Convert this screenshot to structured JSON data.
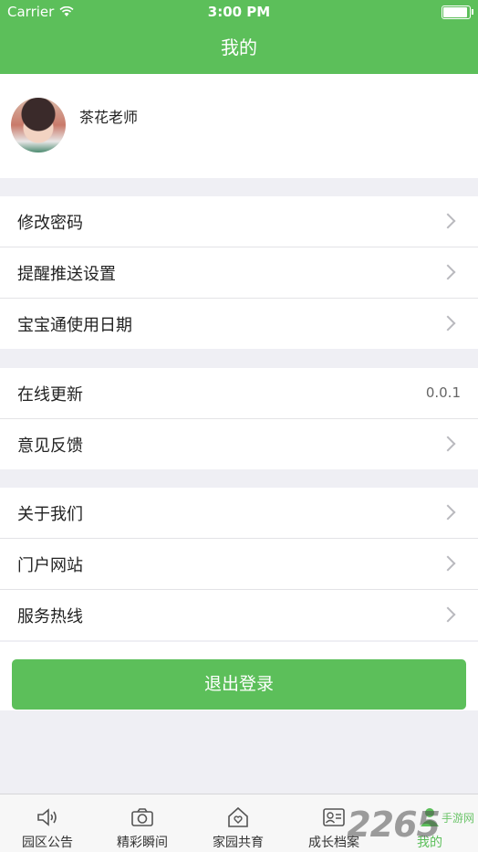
{
  "status_bar": {
    "carrier": "Carrier",
    "time": "3:00 PM",
    "battery_level": 1.0
  },
  "nav": {
    "title": "我的"
  },
  "profile": {
    "name": "茶花老师"
  },
  "menu": {
    "group1": [
      {
        "label": "修改密码"
      },
      {
        "label": "提醒推送设置"
      },
      {
        "label": "宝宝通使用日期"
      }
    ],
    "group2": [
      {
        "label": "在线更新",
        "value": "0.0.1"
      },
      {
        "label": "意见反馈"
      }
    ],
    "group3": [
      {
        "label": "关于我们"
      },
      {
        "label": "门户网站"
      },
      {
        "label": "服务热线"
      }
    ]
  },
  "logout_label": "退出登录",
  "tabs": [
    {
      "label": "园区公告",
      "icon": "speaker-icon"
    },
    {
      "label": "精彩瞬间",
      "icon": "camera-icon"
    },
    {
      "label": "家园共育",
      "icon": "home-heart-icon"
    },
    {
      "label": "成长档案",
      "icon": "profile-card-icon"
    },
    {
      "label": "我的",
      "icon": "person-icon",
      "active": true
    }
  ],
  "colors": {
    "brand": "#5cbf5a",
    "background": "#efeff4"
  },
  "watermark": {
    "text": "2265",
    "subtext": "手游网"
  }
}
